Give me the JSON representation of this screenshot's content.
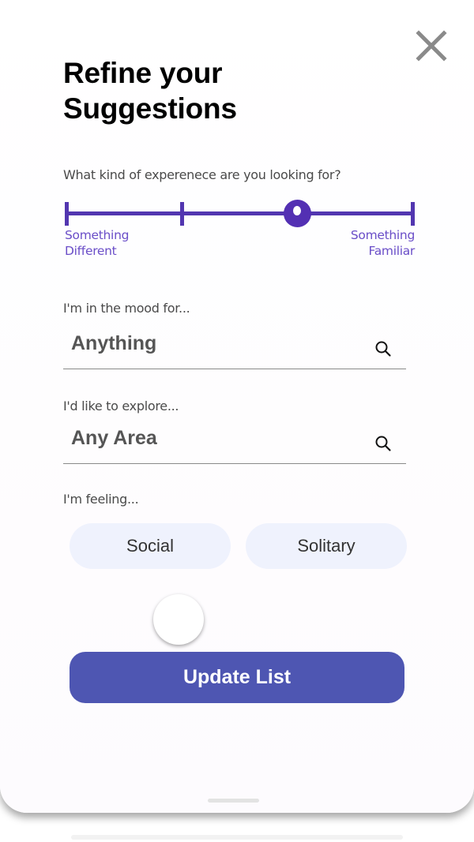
{
  "sheet": {
    "title": "Refine your Suggestions",
    "close_icon": "close-icon"
  },
  "experience": {
    "prompt": "What kind of experenece are you looking for?",
    "left_label": "Something\nDifferent",
    "right_label": "Something\nFamiliar",
    "stops": 4,
    "selected_stop": 3,
    "accent_color": "#5236b0"
  },
  "mood": {
    "prompt": "I'm in the mood for...",
    "value": "Anything",
    "icon": "search-icon"
  },
  "explore": {
    "prompt": "I'd like to explore...",
    "value": "Any Area",
    "icon": "search-icon"
  },
  "feeling": {
    "prompt": "I'm feeling...",
    "options": [
      "Social",
      "Solitary"
    ],
    "pill_color": "#eff2fd"
  },
  "actions": {
    "update_label": "Update List",
    "button_color": "#4e56b2"
  }
}
